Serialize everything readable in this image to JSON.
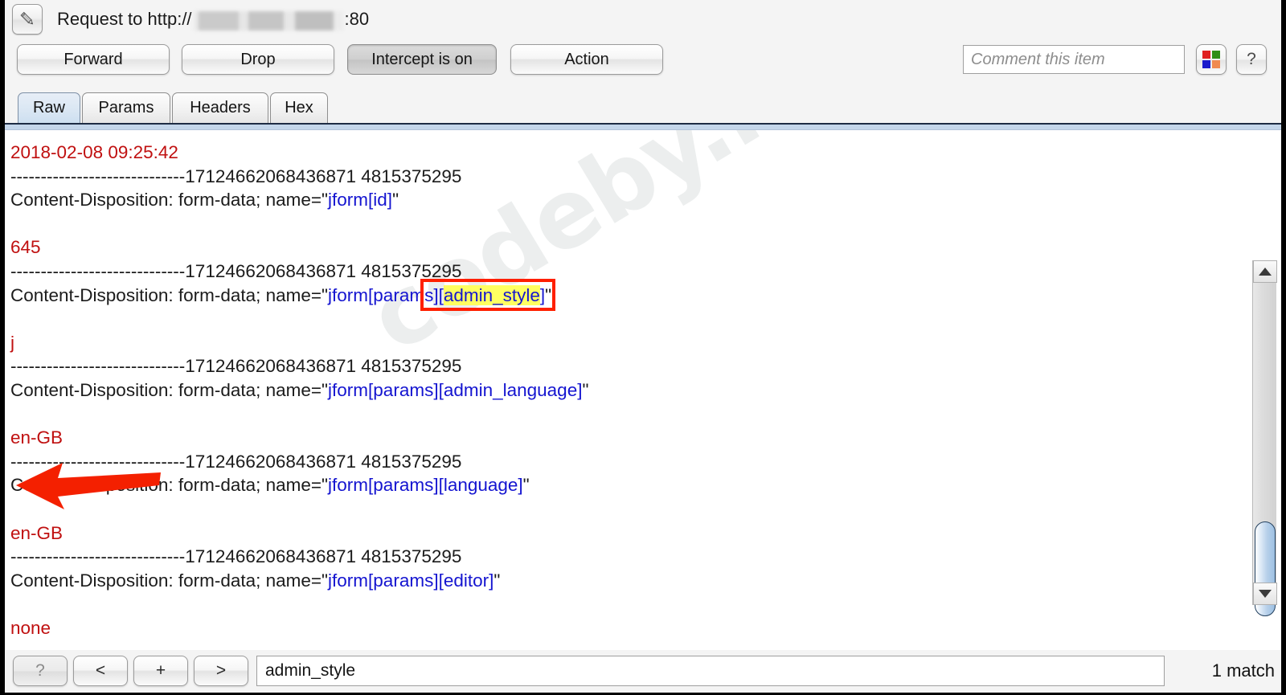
{
  "window": {
    "title_prefix": "Request to http://",
    "host_redacted": "",
    "title_suffix": ":80",
    "edit_icon": "pencil-icon"
  },
  "toolbar": {
    "forward_label": "Forward",
    "drop_label": "Drop",
    "intercept_label": "Intercept is on",
    "action_label": "Action",
    "comment_placeholder": "Comment this item",
    "colors_icon": "color-swatch-icon",
    "help_label": "?",
    "swatch_colors": [
      "#e02020",
      "#2f8f16",
      "#1a1acc",
      "#f08a50"
    ]
  },
  "tabs": [
    {
      "label": "Raw",
      "active": true
    },
    {
      "label": "Params",
      "active": false
    },
    {
      "label": "Headers",
      "active": false
    },
    {
      "label": "Hex",
      "active": false
    }
  ],
  "content": {
    "boundary": "-----------------------------17124662068436871 4815375295",
    "watermark": "codeby.net",
    "lines": [
      {
        "type": "value",
        "text": "2018-02-08 09:25:42"
      },
      {
        "type": "boundary",
        "text": "-----------------------------17124662068436871 4815375295"
      },
      {
        "type": "header",
        "prefix": "Content-Disposition: form-data; name=\"",
        "key": "jform[id]",
        "suffix": "\""
      },
      {
        "type": "blank"
      },
      {
        "type": "value",
        "text": "645"
      },
      {
        "type": "boundary",
        "text": "-----------------------------17124662068436871 4815375295"
      },
      {
        "type": "header-highlight",
        "prefix": "Content-Disposition: form-data; name=\"",
        "key_before": "jform[param",
        "key_boxed_pre": "s][",
        "key_highlight": "admin_style",
        "key_after": "]",
        "suffix": "\""
      },
      {
        "type": "blank"
      },
      {
        "type": "value",
        "text": "j"
      },
      {
        "type": "boundary",
        "text": "-----------------------------17124662068436871 4815375295"
      },
      {
        "type": "header",
        "prefix": "Content-Disposition: form-data; name=\"",
        "key": "jform[params][admin_language]",
        "suffix": "\""
      },
      {
        "type": "blank"
      },
      {
        "type": "value",
        "text": "en-GB"
      },
      {
        "type": "boundary",
        "text": "-----------------------------17124662068436871 4815375295"
      },
      {
        "type": "header",
        "prefix": "Content-Disposition: form-data; name=\"",
        "key": "jform[params][language]",
        "suffix": "\""
      },
      {
        "type": "blank"
      },
      {
        "type": "value",
        "text": "en-GB"
      },
      {
        "type": "boundary",
        "text": "-----------------------------17124662068436871 4815375295"
      },
      {
        "type": "header",
        "prefix": "Content-Disposition: form-data; name=\"",
        "key": "jform[params][editor]",
        "suffix": "\""
      },
      {
        "type": "blank"
      },
      {
        "type": "value",
        "text": "none"
      }
    ],
    "annotation": {
      "arrow": "red-left-arrow",
      "highlight_term": "admin_style",
      "highlight_color": "#ffff61",
      "box_color": "#ff2000"
    }
  },
  "scrollbar": {
    "up_arrow": "scroll-up-icon",
    "down_arrow": "scroll-down-icon"
  },
  "footer": {
    "help_label": "?",
    "prev_label": "<",
    "add_label": "+",
    "next_label": ">",
    "search_value": "admin_style",
    "match_text": "1 match"
  }
}
